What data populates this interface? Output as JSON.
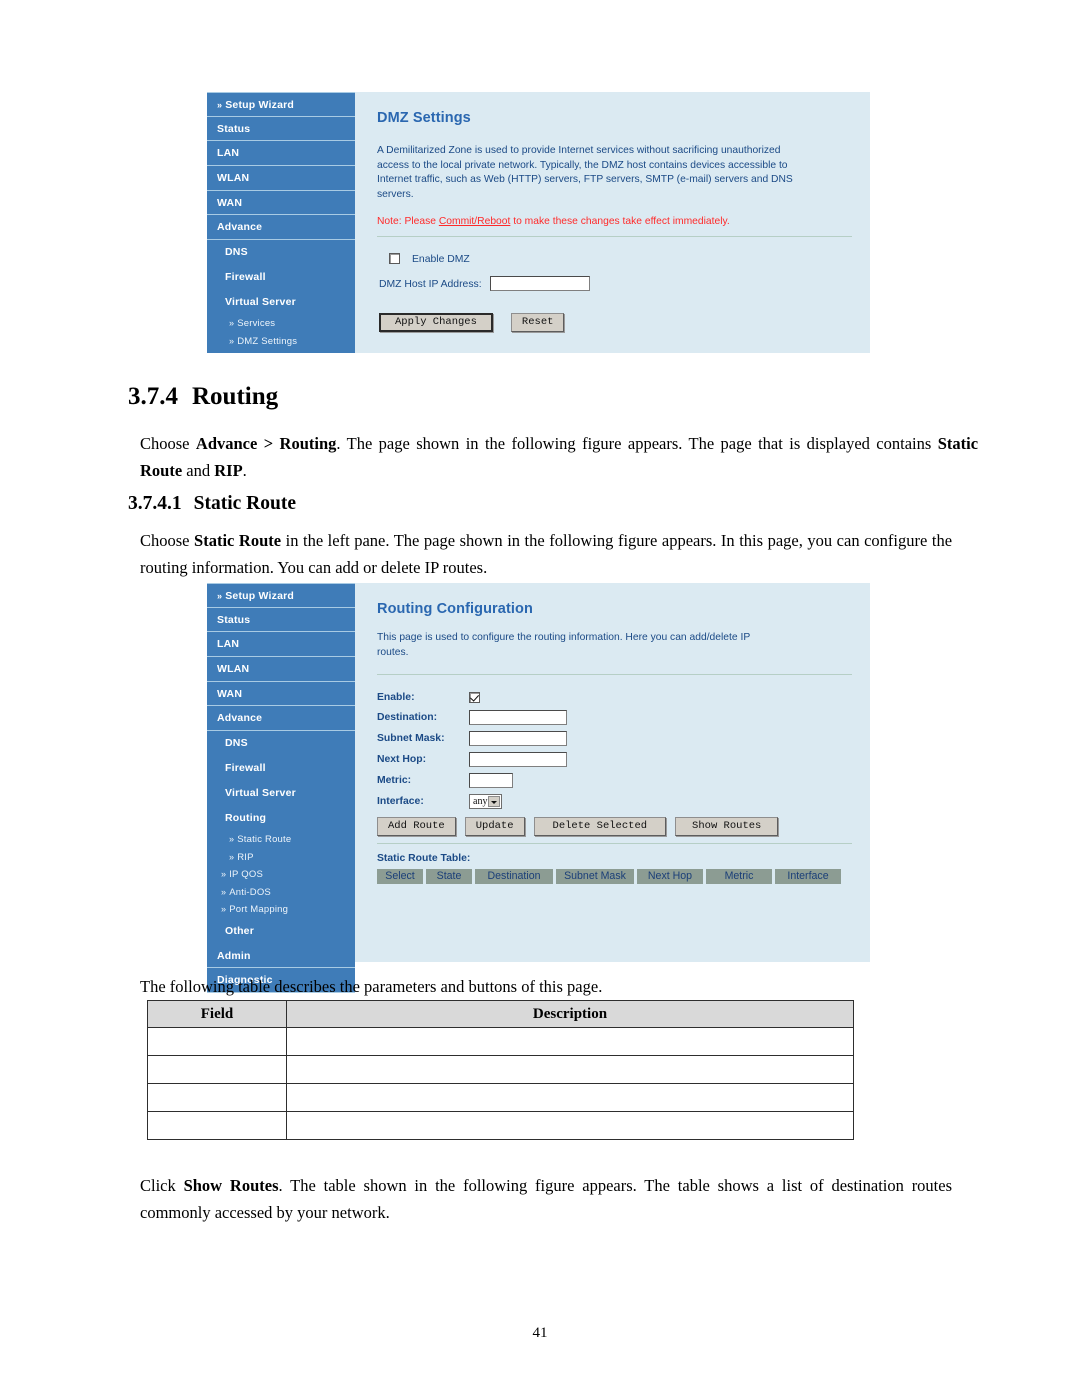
{
  "document": {
    "page_number": "41",
    "headings": {
      "h2_number": "3.7.4",
      "h2_title": "Routing",
      "h3_number": "3.7.4.1",
      "h3_title": "Static Route"
    },
    "paragraphs": {
      "routing_intro_1": "Choose ",
      "routing_intro_bold_1": "Advance > Routing",
      "routing_intro_2": ". The page shown in the following figure appears. The page that is displayed contains ",
      "routing_intro_bold_2": "Static Route",
      "routing_intro_3": " and ",
      "routing_intro_bold_3": "RIP",
      "routing_intro_4": ".",
      "static_intro_1": "Choose ",
      "static_intro_bold_1": "Static Route",
      "static_intro_2": " in the left pane. The page shown in the following figure appears. In this page, you can configure the routing information. You can add or delete IP routes.",
      "table_lead": "The following table describes the parameters and buttons of this page.",
      "show_routes_1": "Click ",
      "show_routes_bold_1": "Show Routes",
      "show_routes_2": ". The table shown in the following figure appears. The table shows a list of destination routes commonly accessed by your network."
    },
    "param_table": {
      "headers": [
        "Field",
        "Description"
      ],
      "rows": [
        [
          "",
          ""
        ],
        [
          "",
          ""
        ],
        [
          "",
          ""
        ],
        [
          "",
          ""
        ]
      ]
    }
  },
  "figure_dmz": {
    "sidebar": [
      {
        "label": "Setup Wizard",
        "level": "top",
        "chevron": "»"
      },
      {
        "label": "Status",
        "level": "top",
        "chevron": ""
      },
      {
        "label": "LAN",
        "level": "top",
        "chevron": ""
      },
      {
        "label": "WLAN",
        "level": "top",
        "chevron": ""
      },
      {
        "label": "WAN",
        "level": "top",
        "chevron": ""
      },
      {
        "label": "Advance",
        "level": "top",
        "chevron": ""
      },
      {
        "label": "DNS",
        "level": "sub",
        "chevron": ""
      },
      {
        "label": "Firewall",
        "level": "sub",
        "chevron": ""
      },
      {
        "label": "Virtual Server",
        "level": "sub",
        "chevron": ""
      },
      {
        "label": "Services",
        "level": "leaf-deep",
        "chevron": "»"
      },
      {
        "label": "DMZ Settings",
        "level": "leaf-deep",
        "chevron": "»"
      }
    ],
    "title": "DMZ Settings",
    "description": "A Demilitarized Zone is used to provide Internet services without sacrificing unauthorized access to the local private network. Typically, the DMZ host contains devices accessible to Internet traffic, such as Web (HTTP) servers, FTP servers, SMTP (e-mail) servers and DNS servers.",
    "note_prefix": "Note: Please ",
    "note_link": "Commit/Reboot",
    "note_suffix": " to make these changes take effect immediately.",
    "enable_dmz_label": "Enable DMZ",
    "enable_dmz_checked": false,
    "host_ip_label": "DMZ Host IP Address:",
    "host_ip_value": "",
    "buttons": {
      "apply": "Apply Changes",
      "reset": "Reset"
    }
  },
  "figure_routing": {
    "sidebar": [
      {
        "label": "Setup Wizard",
        "level": "top",
        "chevron": "»"
      },
      {
        "label": "Status",
        "level": "top",
        "chevron": ""
      },
      {
        "label": "LAN",
        "level": "top",
        "chevron": ""
      },
      {
        "label": "WLAN",
        "level": "top",
        "chevron": ""
      },
      {
        "label": "WAN",
        "level": "top",
        "chevron": ""
      },
      {
        "label": "Advance",
        "level": "top",
        "chevron": ""
      },
      {
        "label": "DNS",
        "level": "sub",
        "chevron": ""
      },
      {
        "label": "Firewall",
        "level": "sub",
        "chevron": ""
      },
      {
        "label": "Virtual Server",
        "level": "sub",
        "chevron": ""
      },
      {
        "label": "Routing",
        "level": "sub",
        "chevron": ""
      },
      {
        "label": "Static Route",
        "level": "leaf-deep",
        "chevron": "»"
      },
      {
        "label": "RIP",
        "level": "leaf-deep",
        "chevron": "»"
      },
      {
        "label": "IP QOS",
        "level": "leaf",
        "chevron": "»"
      },
      {
        "label": "Anti-DOS",
        "level": "leaf",
        "chevron": "»"
      },
      {
        "label": "Port Mapping",
        "level": "leaf",
        "chevron": "»"
      },
      {
        "label": "Other",
        "level": "sub",
        "chevron": ""
      },
      {
        "label": "Admin",
        "level": "top",
        "chevron": ""
      },
      {
        "label": "Diagnostic",
        "level": "top",
        "chevron": ""
      }
    ],
    "title": "Routing Configuration",
    "description": "This page is used to configure the routing information. Here you can add/delete IP routes.",
    "fields": {
      "enable_label": "Enable:",
      "enable_checked": true,
      "destination_label": "Destination:",
      "destination_value": "",
      "subnet_mask_label": "Subnet Mask:",
      "subnet_mask_value": "",
      "next_hop_label": "Next Hop:",
      "next_hop_value": "",
      "metric_label": "Metric:",
      "metric_value": "",
      "interface_label": "Interface:",
      "interface_value": "any"
    },
    "buttons": {
      "add_route": "Add Route",
      "update": "Update",
      "delete_selected": "Delete Selected",
      "show_routes": "Show Routes"
    },
    "static_route_table_label": "Static Route Table:",
    "static_route_table_headers": [
      "Select",
      "State",
      "Destination",
      "Subnet Mask",
      "Next Hop",
      "Metric",
      "Interface"
    ]
  },
  "colors": {
    "sidebar_blue": "#3f7cb8",
    "panel_bg": "#dbeaf2",
    "title_blue": "#2a67b0",
    "label_navy": "#1b4a86",
    "note_red": "#ff2a2a",
    "table_header_gray": "#8c9c93",
    "doc_table_header": "#d9d9d9"
  }
}
